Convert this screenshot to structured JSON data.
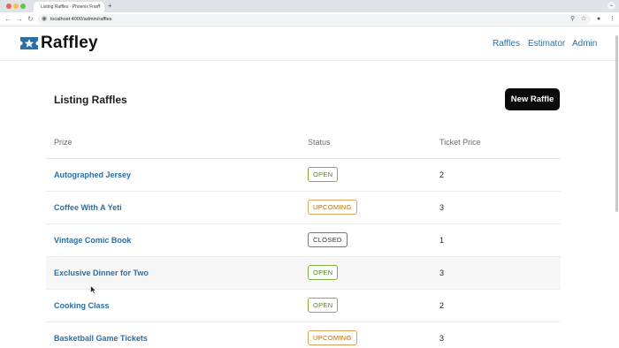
{
  "browser": {
    "tab_title": "Listing Raffles · Phoenix Fram",
    "tab_close": "×",
    "new_tab": "+",
    "tab_chevron": "⌄",
    "back": "←",
    "forward": "→",
    "reload": "↻",
    "site_info_icon": "◉",
    "url": "localhost:4000/admin/raffles",
    "zoom_icon": "⚲",
    "bookmark_icon": "☆",
    "profile_icon": "●",
    "menu_icon": "⋮"
  },
  "header": {
    "logo_text": "Raffley",
    "nav": [
      {
        "label": "Raffles"
      },
      {
        "label": "Estimator"
      },
      {
        "label": "Admin"
      }
    ]
  },
  "main": {
    "title": "Listing Raffles",
    "new_button": "New Raffle",
    "columns": [
      "Prize",
      "Status",
      "Ticket Price"
    ],
    "rows": [
      {
        "prize": "Autographed Jersey",
        "status": "OPEN",
        "price": "2"
      },
      {
        "prize": "Coffee With A Yeti",
        "status": "UPCOMING",
        "price": "3"
      },
      {
        "prize": "Vintage Comic Book",
        "status": "CLOSED",
        "price": "1"
      },
      {
        "prize": "Exclusive Dinner for Two",
        "status": "OPEN",
        "price": "3"
      },
      {
        "prize": "Cooking Class",
        "status": "OPEN",
        "price": "2"
      },
      {
        "prize": "Basketball Game Tickets",
        "status": "UPCOMING",
        "price": "3"
      }
    ]
  },
  "colors": {
    "accent": "#2b6fa6",
    "open": "#4f8a10",
    "upcoming": "#b86a12",
    "closed": "#333333",
    "button_bg": "#0a0a0a"
  }
}
